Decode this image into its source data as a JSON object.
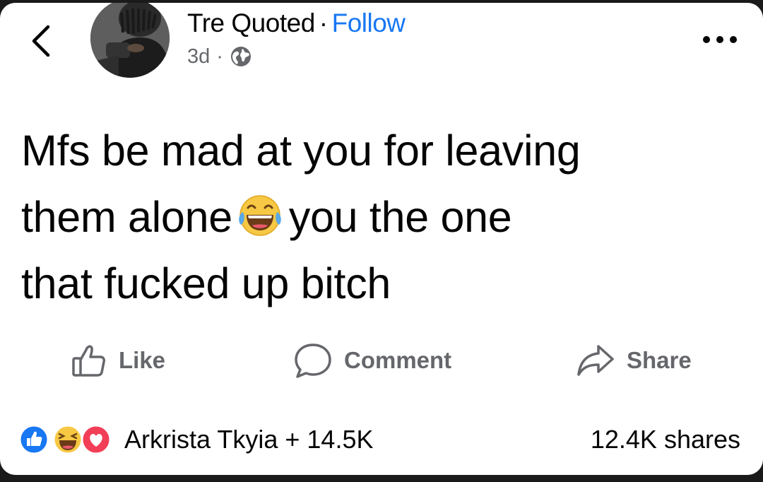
{
  "header": {
    "author_name": "Tre Quoted",
    "separator": "·",
    "follow_label": "Follow",
    "time_ago": "3d",
    "audience_icon": "globe-icon",
    "back_icon": "chevron-left-icon",
    "more_icon": "more-horizontal-icon"
  },
  "post": {
    "line1": "Mfs be mad at you for leaving",
    "line2_before": "them alone",
    "line2_emoji": "face-with-tears-of-joy-emoji",
    "line2_after": "you the one",
    "line3": "that fucked up bitch"
  },
  "actions": {
    "like_label": "Like",
    "comment_label": "Comment",
    "share_label": "Share"
  },
  "footer": {
    "reactions": [
      "like-reaction-icon",
      "haha-reaction-icon",
      "love-reaction-icon"
    ],
    "reactors_text": "Arkrista Tkyia + 14.5K",
    "shares_text": "12.4K shares"
  },
  "colors": {
    "link_blue": "#1877f2",
    "secondary_text": "#65676b",
    "primary_text": "#050505",
    "love_red": "#f33e58",
    "haha_yellow": "#f7c843"
  }
}
